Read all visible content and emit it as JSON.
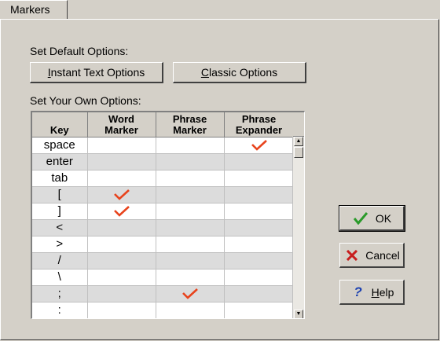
{
  "tab": {
    "label": "Markers"
  },
  "default_section": {
    "label": "Set Default Options:",
    "instant_button": {
      "prefix": "",
      "hotkey": "I",
      "rest": "nstant Text Options"
    },
    "classic_button": {
      "prefix": "",
      "hotkey": "C",
      "rest": "lassic Options"
    }
  },
  "own_section": {
    "label": "Set Your Own Options:"
  },
  "table": {
    "headers": [
      {
        "line1": "",
        "line2": "Key"
      },
      {
        "line1": "Word",
        "line2": "Marker"
      },
      {
        "line1": "Phrase",
        "line2": "Marker"
      },
      {
        "line1": "Phrase",
        "line2": "Expander"
      }
    ],
    "rows": [
      {
        "key": "space",
        "word_marker": false,
        "phrase_marker": false,
        "phrase_expander": true
      },
      {
        "key": "enter",
        "word_marker": false,
        "phrase_marker": false,
        "phrase_expander": false
      },
      {
        "key": "tab",
        "word_marker": false,
        "phrase_marker": false,
        "phrase_expander": false
      },
      {
        "key": "[",
        "word_marker": true,
        "phrase_marker": false,
        "phrase_expander": false
      },
      {
        "key": "]",
        "word_marker": true,
        "phrase_marker": false,
        "phrase_expander": false
      },
      {
        "key": "<",
        "word_marker": false,
        "phrase_marker": false,
        "phrase_expander": false
      },
      {
        "key": ">",
        "word_marker": false,
        "phrase_marker": false,
        "phrase_expander": false
      },
      {
        "key": "/",
        "word_marker": false,
        "phrase_marker": false,
        "phrase_expander": false
      },
      {
        "key": "\\",
        "word_marker": false,
        "phrase_marker": false,
        "phrase_expander": false
      },
      {
        "key": ";",
        "word_marker": false,
        "phrase_marker": true,
        "phrase_expander": false
      },
      {
        "key": ":",
        "word_marker": false,
        "phrase_marker": false,
        "phrase_expander": false
      }
    ]
  },
  "buttons": {
    "ok": {
      "label": "OK",
      "icon": "green-checkmark-icon"
    },
    "cancel": {
      "label": "Cancel",
      "icon": "red-x-icon"
    },
    "help": {
      "hotkey": "H",
      "rest": "elp",
      "icon": "blue-question-icon"
    }
  },
  "colors": {
    "check": "#e8431c",
    "ok_check": "#2a9a2a",
    "cancel_x": "#c81e1e",
    "help_q": "#1a3fb0"
  }
}
